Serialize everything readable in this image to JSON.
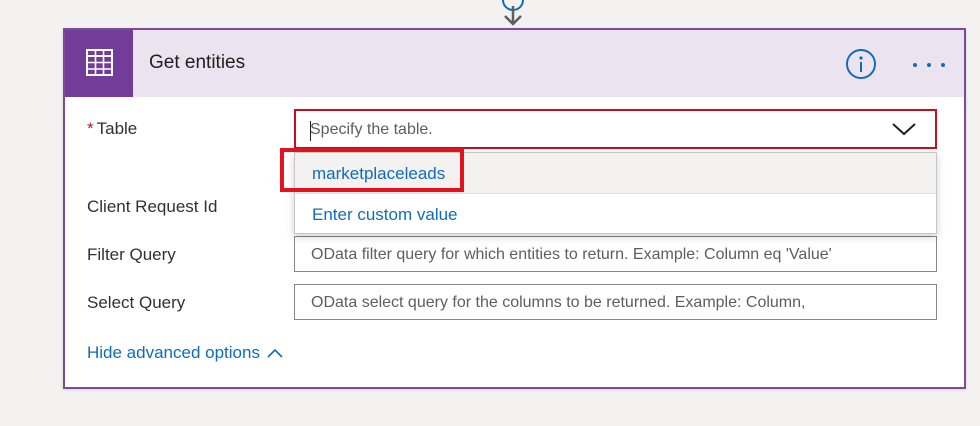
{
  "card": {
    "title": "Get entities",
    "accent_color": "#743c99",
    "header_bg": "#ece3f1",
    "icons": {
      "app": "table-grid-icon",
      "info": "info-icon",
      "more": "more-options-icon"
    }
  },
  "fields": {
    "table": {
      "label": "Table",
      "required_mark": "*",
      "placeholder": "Specify the table."
    },
    "client_request_id": {
      "label": "Client Request Id"
    },
    "filter_query": {
      "label": "Filter Query",
      "placeholder": "OData filter query for which entities to return. Example: Column eq 'Value'"
    },
    "select_query": {
      "label": "Select Query",
      "placeholder": "OData select query for the columns to be returned. Example: Column,"
    }
  },
  "dropdown": {
    "options": [
      {
        "label": "marketplaceleads"
      },
      {
        "label": "Enter custom value"
      }
    ]
  },
  "advanced": {
    "toggle_label": "Hide advanced options"
  },
  "colors": {
    "link": "#0f6cbd",
    "error_border": "#c50f1f",
    "highlight": "#e4121d"
  }
}
